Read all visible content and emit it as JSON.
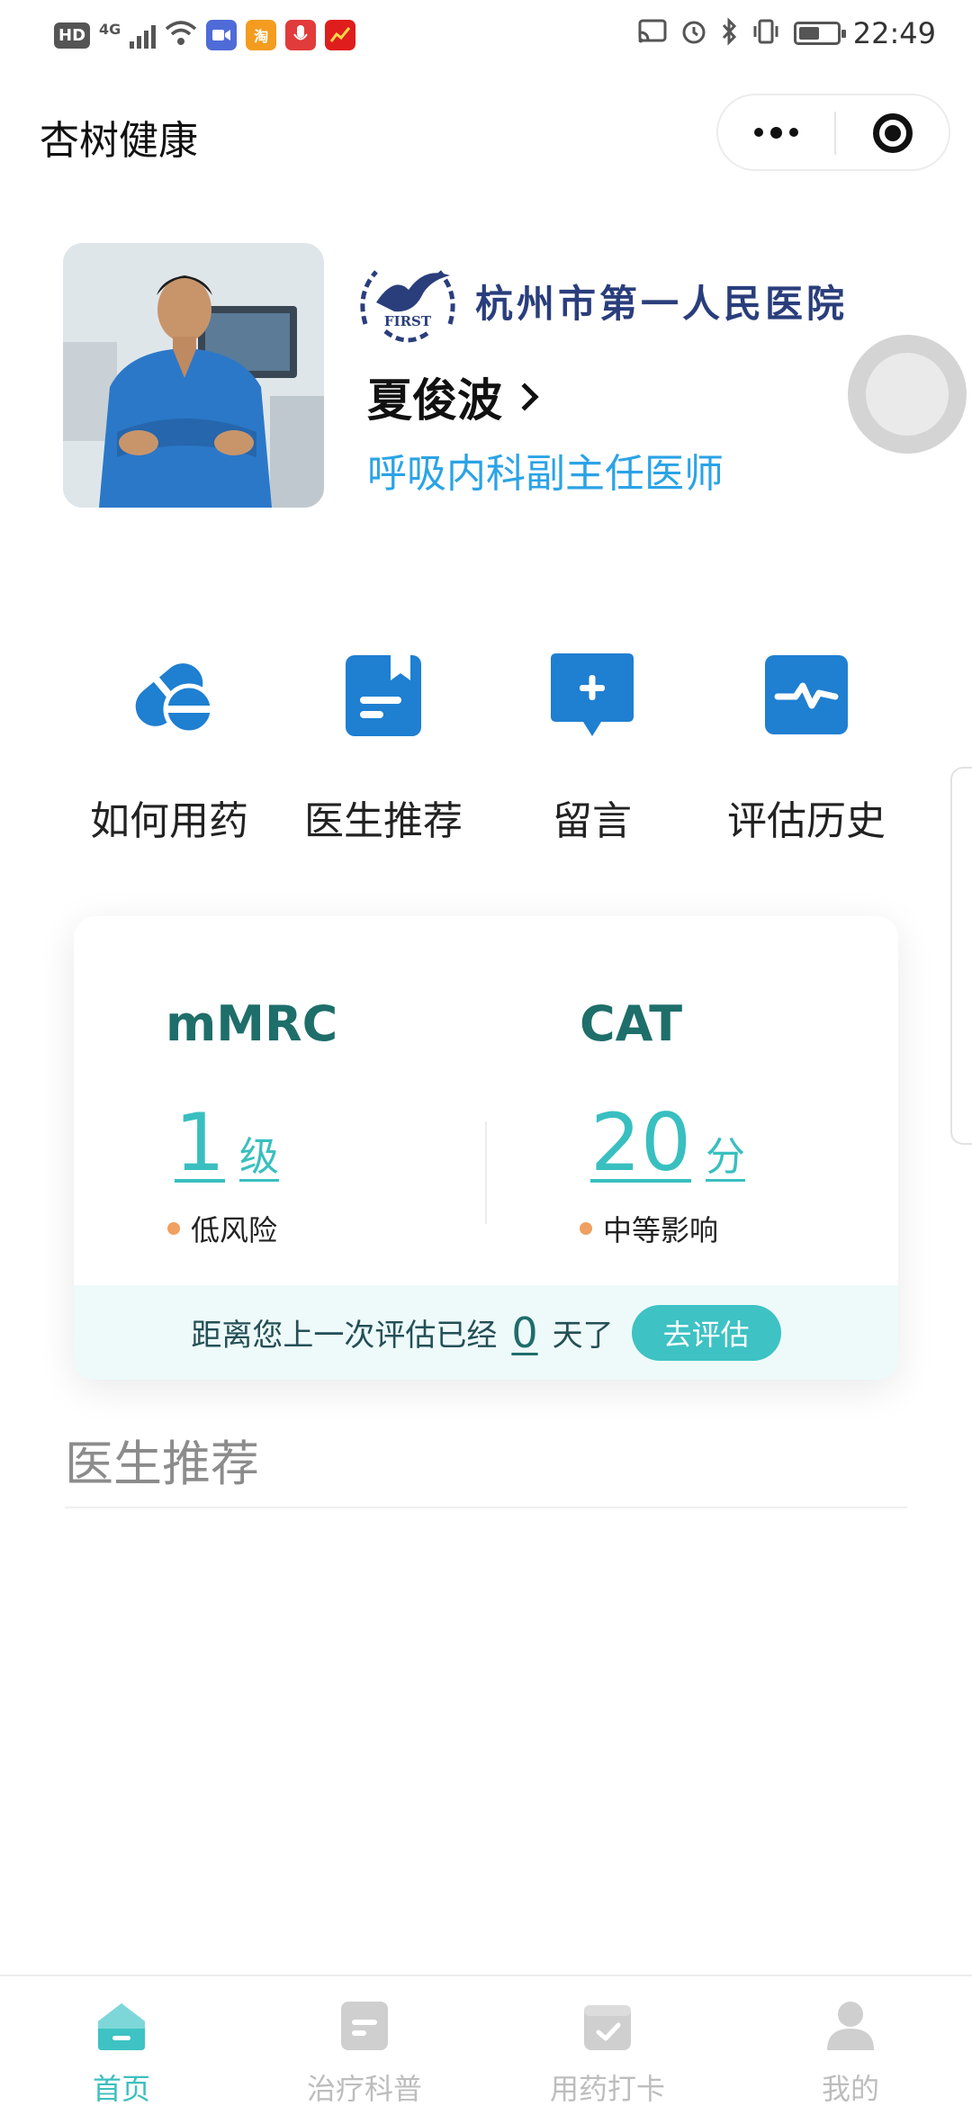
{
  "status_bar": {
    "hd_badge": "HD",
    "network": "4G",
    "app_badge_taobao": "淘",
    "time": "22:49"
  },
  "title_bar": {
    "app_title": "杏树健康",
    "more_icon": "more-dots-icon",
    "close_icon": "target-close-icon"
  },
  "doctor": {
    "hospital_name": "杭州市第一人民医院",
    "logo_text": "FIRST",
    "name": "夏俊波",
    "title": "呼吸内科副主任医师"
  },
  "quick_actions": [
    {
      "label": "如何用药",
      "icon": "pill-icon"
    },
    {
      "label": "医生推荐",
      "icon": "bookmark-doc-icon"
    },
    {
      "label": "留言",
      "icon": "message-plus-icon"
    },
    {
      "label": "评估历史",
      "icon": "pulse-icon"
    }
  ],
  "assessment": {
    "mmrc": {
      "name": "mMRC",
      "value": "1",
      "unit": "级",
      "note": "低风险"
    },
    "cat": {
      "name": "CAT",
      "value": "20",
      "unit": "分",
      "note": "中等影响"
    },
    "footer_prefix": "距离您上一次评估已经",
    "days": "0",
    "footer_suffix": "天了",
    "button_label": "去评估"
  },
  "recommend": {
    "title": "医生推荐"
  },
  "tabs": [
    {
      "label": "首页",
      "icon": "home-icon",
      "active": true
    },
    {
      "label": "治疗科普",
      "icon": "article-icon",
      "active": false
    },
    {
      "label": "用药打卡",
      "icon": "checkin-icon",
      "active": false
    },
    {
      "label": "我的",
      "icon": "user-icon",
      "active": false
    }
  ],
  "colors": {
    "accent": "#3ec2c4",
    "blue_icon": "#1f7fd1",
    "metric_title": "#1e6e6a",
    "doctor_title": "#2ba3e6"
  }
}
